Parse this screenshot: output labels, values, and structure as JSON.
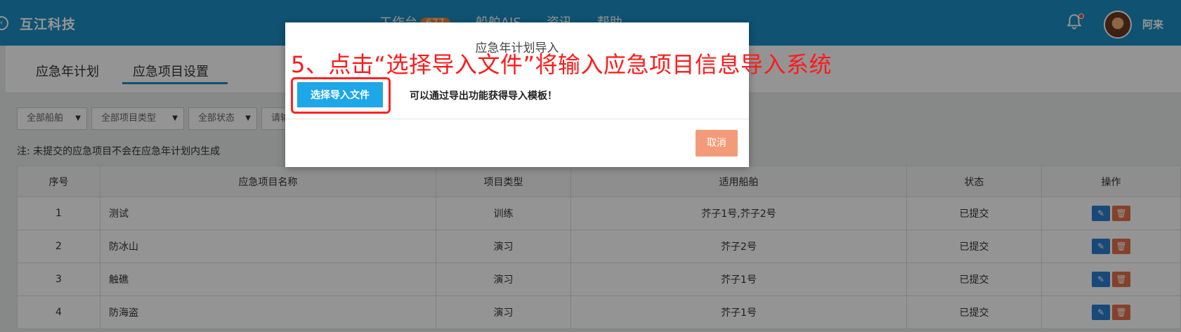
{
  "header": {
    "brand": "互江科技",
    "nav": [
      {
        "label": "工作台",
        "badge": "677"
      },
      {
        "label": "船舶AIS"
      },
      {
        "label": "资讯"
      },
      {
        "label": "帮助"
      }
    ],
    "username": "阿来"
  },
  "tabs": [
    "应急年计划",
    "应急项目设置"
  ],
  "filters": {
    "ship": "全部船舶",
    "type": "全部项目类型",
    "status": "全部状态",
    "search_placeholder": "请输"
  },
  "note": "注: 未提交的应急项目不会在应急年计划内生成",
  "table": {
    "headers": [
      "序号",
      "应急项目名称",
      "项目类型",
      "适用船舶",
      "状态",
      "操作"
    ],
    "rows": [
      {
        "no": "1",
        "name": "测试",
        "type": "训练",
        "ships": "芥子1号,芥子2号",
        "status": "已提交"
      },
      {
        "no": "2",
        "name": "防冰山",
        "type": "演习",
        "ships": "芥子2号",
        "status": "已提交"
      },
      {
        "no": "3",
        "name": "触礁",
        "type": "演习",
        "ships": "芥子1号",
        "status": "已提交"
      },
      {
        "no": "4",
        "name": "防海盗",
        "type": "演习",
        "ships": "芥子1号",
        "status": "已提交"
      }
    ]
  },
  "modal": {
    "title": "应急年计划导入",
    "instruction": "5、点击“选择导入文件”将输入应急项目信息导入系统",
    "choose_button": "选择导入文件",
    "hint": "可以通过导出功能获得导入模板！",
    "cancel_button": "取消"
  },
  "colors": {
    "topbar": "#1b8dc4",
    "primary_button": "#1ea7e8",
    "cancel_button": "#f39b78",
    "annotation": "#ff1a1a"
  }
}
